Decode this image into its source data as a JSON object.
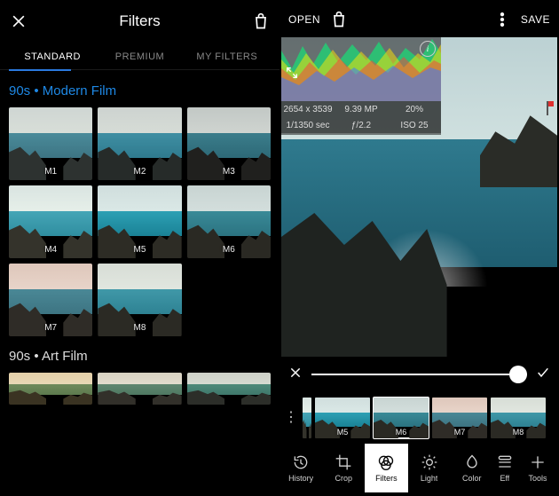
{
  "left": {
    "title": "Filters",
    "tabs": [
      "STANDARD",
      "PREMIUM",
      "MY FILTERS"
    ],
    "active_tab": 0,
    "sections": {
      "modern_film": {
        "title": "90s • Modern Film",
        "thumbs": [
          "M1",
          "M2",
          "M3",
          "M4",
          "M5",
          "M6",
          "M7",
          "M8"
        ]
      },
      "art_film": {
        "title": "90s • Art Film"
      }
    }
  },
  "right": {
    "header": {
      "open": "OPEN",
      "save": "SAVE"
    },
    "histogram": {
      "dimensions": "2654 x 3539",
      "megapixels": "9.39 MP",
      "zoom": "20%",
      "shutter": "1/1350 sec",
      "aperture": "ƒ/2.2",
      "iso": "ISO 25"
    },
    "filmstrip": [
      "M5",
      "M6",
      "M7",
      "M8"
    ],
    "filmstrip_selected": 1,
    "tools": [
      {
        "label": "History"
      },
      {
        "label": "Crop"
      },
      {
        "label": "Filters"
      },
      {
        "label": "Light"
      },
      {
        "label": "Color"
      },
      {
        "label": "Effects"
      },
      {
        "label": "Tools"
      }
    ],
    "active_tool": 2
  }
}
